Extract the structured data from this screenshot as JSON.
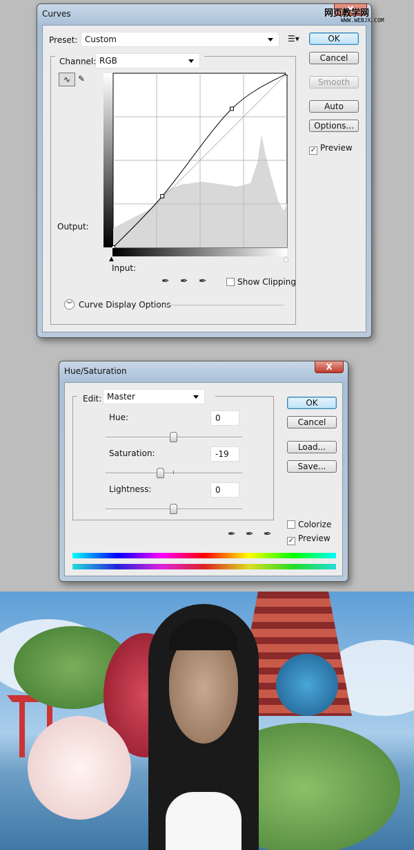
{
  "watermark": {
    "line1": "网页教学网",
    "line2": "WWW.WEBJX.COM"
  },
  "curves": {
    "title": "Curves",
    "preset_label": "Preset:",
    "preset_value": "Custom",
    "channel_label": "Channel:",
    "channel_value": "RGB",
    "output_label": "Output:",
    "input_label": "Input:",
    "show_clipping": "Show Clipping",
    "show_clipping_checked": false,
    "display_options": "Curve Display Options",
    "buttons": {
      "ok": "OK",
      "cancel": "Cancel",
      "smooth": "Smooth",
      "auto": "Auto",
      "options": "Options..."
    },
    "preview": "Preview",
    "preview_checked": true,
    "curve_points": [
      [
        0,
        0
      ],
      [
        72,
        75
      ],
      [
        174,
        203
      ],
      [
        255,
        255
      ]
    ]
  },
  "hue_sat": {
    "title": "Hue/Saturation",
    "edit_label": "Edit:",
    "edit_value": "Master",
    "hue_label": "Hue:",
    "hue_value": "0",
    "saturation_label": "Saturation:",
    "saturation_value": "-19",
    "lightness_label": "Lightness:",
    "lightness_value": "0",
    "buttons": {
      "ok": "OK",
      "cancel": "Cancel",
      "load": "Load...",
      "save": "Save..."
    },
    "colorize": "Colorize",
    "colorize_checked": false,
    "preview": "Preview",
    "preview_checked": true,
    "close": "X"
  }
}
